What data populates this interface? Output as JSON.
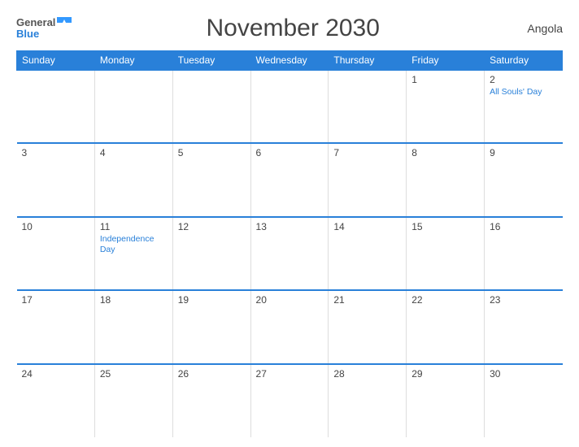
{
  "header": {
    "logo_general": "General",
    "logo_blue": "Blue",
    "title": "November 2030",
    "country": "Angola"
  },
  "days_of_week": [
    "Sunday",
    "Monday",
    "Tuesday",
    "Wednesday",
    "Thursday",
    "Friday",
    "Saturday"
  ],
  "weeks": [
    [
      {
        "day": "",
        "holiday": ""
      },
      {
        "day": "",
        "holiday": ""
      },
      {
        "day": "",
        "holiday": ""
      },
      {
        "day": "",
        "holiday": ""
      },
      {
        "day": "",
        "holiday": ""
      },
      {
        "day": "1",
        "holiday": ""
      },
      {
        "day": "2",
        "holiday": "All Souls' Day"
      }
    ],
    [
      {
        "day": "3",
        "holiday": ""
      },
      {
        "day": "4",
        "holiday": ""
      },
      {
        "day": "5",
        "holiday": ""
      },
      {
        "day": "6",
        "holiday": ""
      },
      {
        "day": "7",
        "holiday": ""
      },
      {
        "day": "8",
        "holiday": ""
      },
      {
        "day": "9",
        "holiday": ""
      }
    ],
    [
      {
        "day": "10",
        "holiday": ""
      },
      {
        "day": "11",
        "holiday": "Independence Day"
      },
      {
        "day": "12",
        "holiday": ""
      },
      {
        "day": "13",
        "holiday": ""
      },
      {
        "day": "14",
        "holiday": ""
      },
      {
        "day": "15",
        "holiday": ""
      },
      {
        "day": "16",
        "holiday": ""
      }
    ],
    [
      {
        "day": "17",
        "holiday": ""
      },
      {
        "day": "18",
        "holiday": ""
      },
      {
        "day": "19",
        "holiday": ""
      },
      {
        "day": "20",
        "holiday": ""
      },
      {
        "day": "21",
        "holiday": ""
      },
      {
        "day": "22",
        "holiday": ""
      },
      {
        "day": "23",
        "holiday": ""
      }
    ],
    [
      {
        "day": "24",
        "holiday": ""
      },
      {
        "day": "25",
        "holiday": ""
      },
      {
        "day": "26",
        "holiday": ""
      },
      {
        "day": "27",
        "holiday": ""
      },
      {
        "day": "28",
        "holiday": ""
      },
      {
        "day": "29",
        "holiday": ""
      },
      {
        "day": "30",
        "holiday": ""
      }
    ]
  ]
}
